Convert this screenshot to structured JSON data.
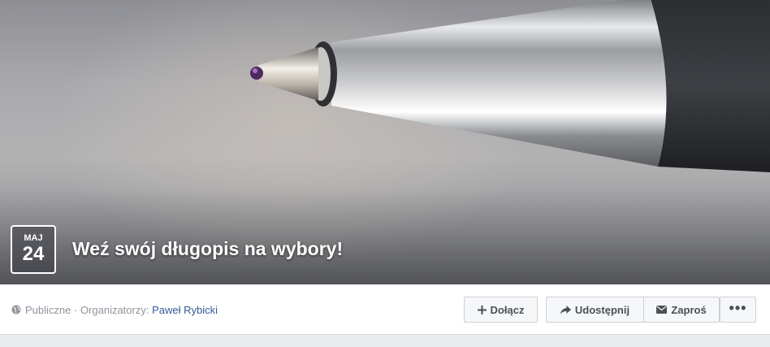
{
  "event": {
    "cover": {
      "image_description_icon": "cover-photo-pen-tip"
    },
    "date": {
      "month": "MAJ",
      "day": "24"
    },
    "title": "Weź swój długopis na wybory!",
    "privacy_label": "Publiczne",
    "separator": " · ",
    "organizers_label": "Organizatorzy:",
    "organizer_name": "Paweł Rybicki",
    "privacy_icon": "globe-icon"
  },
  "actions": {
    "join_label": "Dołącz",
    "join_icon": "plus-icon",
    "share_label": "Udostępnij",
    "share_icon": "share-arrow-icon",
    "invite_label": "Zaproś",
    "invite_icon": "envelope-icon",
    "more_label": "•••",
    "more_icon": "more-dots-icon"
  },
  "colors": {
    "link": "#365899",
    "meta_text": "#90949c",
    "button_text": "#4b4f56",
    "button_bg": "#f6f7f9",
    "page_bg": "#e9ebee"
  }
}
